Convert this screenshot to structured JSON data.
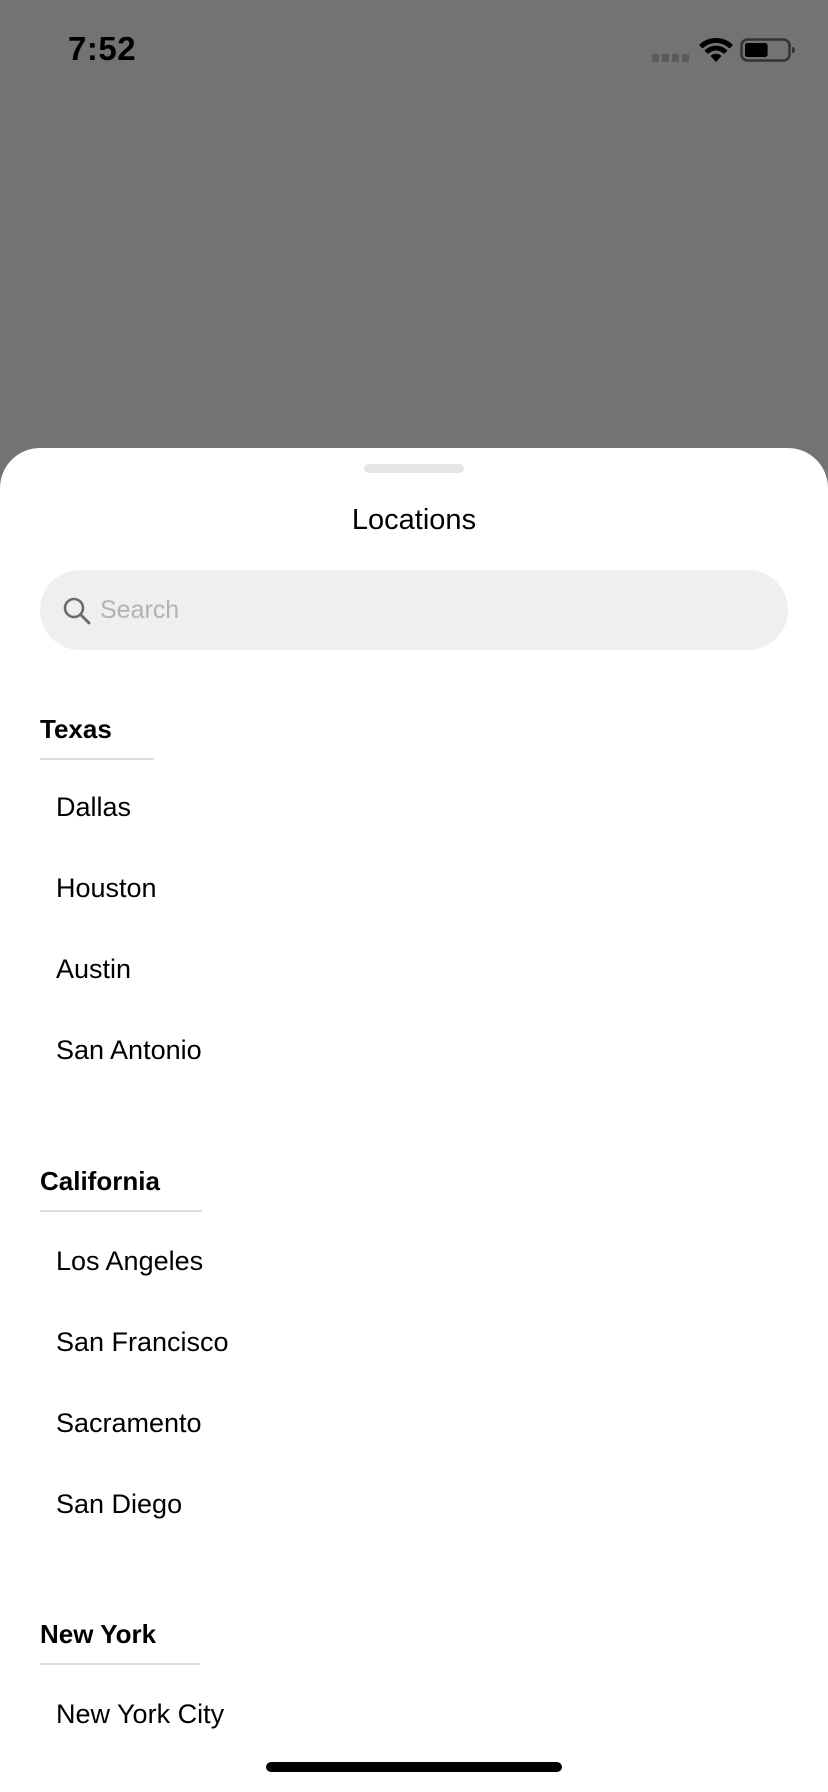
{
  "status_bar": {
    "time": "7:52",
    "icons": [
      "signal-icon",
      "wifi-icon",
      "battery-icon"
    ],
    "battery_level": 0.55
  },
  "sheet": {
    "title": "Locations",
    "search": {
      "placeholder": "Search",
      "value": "",
      "icon": "search-icon"
    },
    "sections": [
      {
        "name": "Texas",
        "cities": [
          "Dallas",
          "Houston",
          "Austin",
          "San Antonio"
        ]
      },
      {
        "name": "California",
        "cities": [
          "Los Angeles",
          "San Francisco",
          "Sacramento",
          "San Diego"
        ]
      },
      {
        "name": "New York",
        "cities": [
          "New York City"
        ]
      }
    ]
  },
  "colors": {
    "overlay": "#737373",
    "sheet_background": "#ffffff",
    "search_background": "#efefef",
    "placeholder": "#b3b3b3",
    "divider": "#dcdcdc"
  }
}
